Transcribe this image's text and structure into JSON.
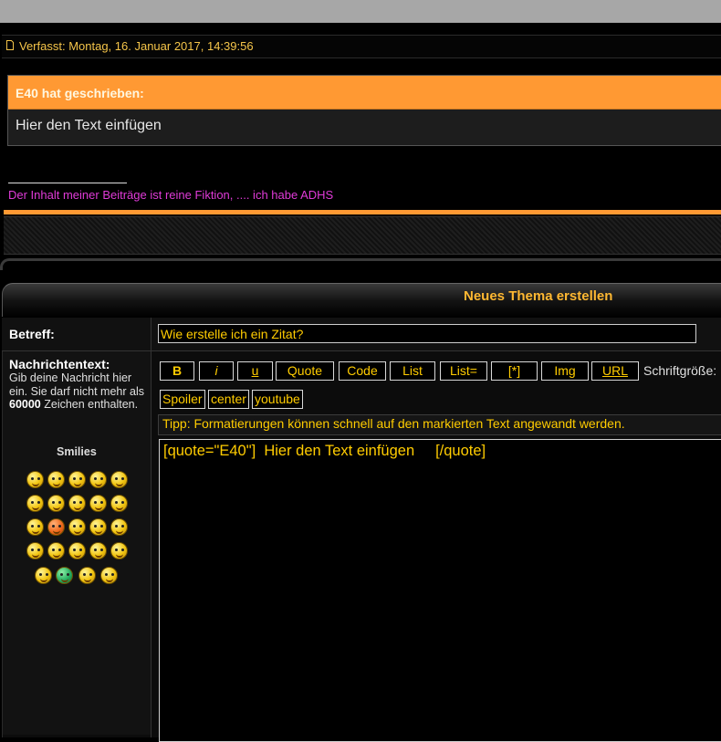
{
  "post": {
    "meta": "Verfasst: Montag, 16. Januar 2017, 14:39:56",
    "quote_author": "E40 hat geschrieben:",
    "quote_text": "Hier den Text einfügen",
    "signature_line": "_______________",
    "signature": "Der Inhalt meiner Beiträge ist reine Fiktion, .... ich habe ADHS"
  },
  "form": {
    "title": "Neues Thema erstellen",
    "subject_label": "Betreff:",
    "subject_value": "Wie erstelle ich ein Zitat?",
    "message_label": "Nachrichtentext:",
    "message_hint_pre": "Gib deine Nachricht hier ein. Sie darf nicht mehr als ",
    "message_hint_count": "60000",
    "message_hint_post": " Zeichen enthalten.",
    "smilies_label": "Smilies",
    "toolbar": [
      "B",
      "i",
      "u",
      "Quote",
      "Code",
      "List",
      "List=",
      "[*]",
      "Img",
      "URL"
    ],
    "font_size_label": "Schriftgröße:",
    "toolbar2": [
      "Spoiler",
      "center",
      "youtube"
    ],
    "tip": "Tipp: Formatierungen können schnell auf den markierten Text angewandt werden.",
    "editor_text": "[quote=\"E40\"]  Hier den Text einfügen     [/quote]"
  },
  "colors": {
    "accent_orange": "#ff9933",
    "text_yellow": "#ffcc00",
    "signature_magenta": "#e03bd8"
  }
}
